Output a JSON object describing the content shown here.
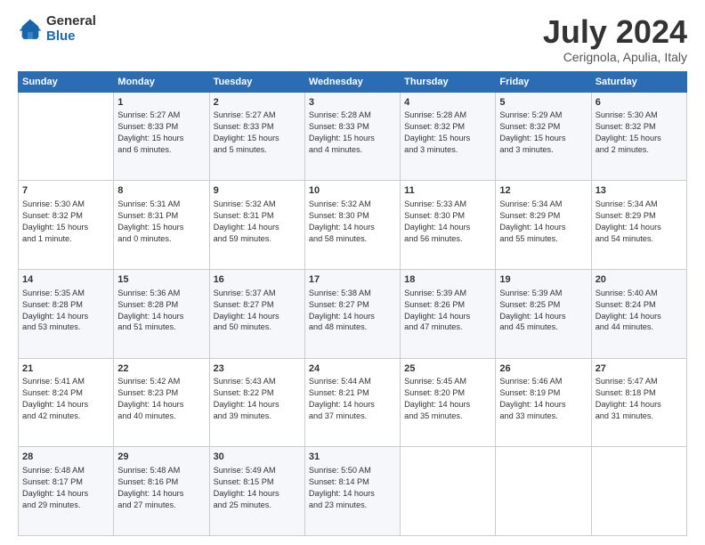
{
  "logo": {
    "general": "General",
    "blue": "Blue"
  },
  "header": {
    "title": "July 2024",
    "subtitle": "Cerignola, Apulia, Italy"
  },
  "weekdays": [
    "Sunday",
    "Monday",
    "Tuesday",
    "Wednesday",
    "Thursday",
    "Friday",
    "Saturday"
  ],
  "weeks": [
    [
      {
        "day": "",
        "info": ""
      },
      {
        "day": "1",
        "info": "Sunrise: 5:27 AM\nSunset: 8:33 PM\nDaylight: 15 hours\nand 6 minutes."
      },
      {
        "day": "2",
        "info": "Sunrise: 5:27 AM\nSunset: 8:33 PM\nDaylight: 15 hours\nand 5 minutes."
      },
      {
        "day": "3",
        "info": "Sunrise: 5:28 AM\nSunset: 8:33 PM\nDaylight: 15 hours\nand 4 minutes."
      },
      {
        "day": "4",
        "info": "Sunrise: 5:28 AM\nSunset: 8:32 PM\nDaylight: 15 hours\nand 3 minutes."
      },
      {
        "day": "5",
        "info": "Sunrise: 5:29 AM\nSunset: 8:32 PM\nDaylight: 15 hours\nand 3 minutes."
      },
      {
        "day": "6",
        "info": "Sunrise: 5:30 AM\nSunset: 8:32 PM\nDaylight: 15 hours\nand 2 minutes."
      }
    ],
    [
      {
        "day": "7",
        "info": "Sunrise: 5:30 AM\nSunset: 8:32 PM\nDaylight: 15 hours\nand 1 minute."
      },
      {
        "day": "8",
        "info": "Sunrise: 5:31 AM\nSunset: 8:31 PM\nDaylight: 15 hours\nand 0 minutes."
      },
      {
        "day": "9",
        "info": "Sunrise: 5:32 AM\nSunset: 8:31 PM\nDaylight: 14 hours\nand 59 minutes."
      },
      {
        "day": "10",
        "info": "Sunrise: 5:32 AM\nSunset: 8:30 PM\nDaylight: 14 hours\nand 58 minutes."
      },
      {
        "day": "11",
        "info": "Sunrise: 5:33 AM\nSunset: 8:30 PM\nDaylight: 14 hours\nand 56 minutes."
      },
      {
        "day": "12",
        "info": "Sunrise: 5:34 AM\nSunset: 8:29 PM\nDaylight: 14 hours\nand 55 minutes."
      },
      {
        "day": "13",
        "info": "Sunrise: 5:34 AM\nSunset: 8:29 PM\nDaylight: 14 hours\nand 54 minutes."
      }
    ],
    [
      {
        "day": "14",
        "info": "Sunrise: 5:35 AM\nSunset: 8:28 PM\nDaylight: 14 hours\nand 53 minutes."
      },
      {
        "day": "15",
        "info": "Sunrise: 5:36 AM\nSunset: 8:28 PM\nDaylight: 14 hours\nand 51 minutes."
      },
      {
        "day": "16",
        "info": "Sunrise: 5:37 AM\nSunset: 8:27 PM\nDaylight: 14 hours\nand 50 minutes."
      },
      {
        "day": "17",
        "info": "Sunrise: 5:38 AM\nSunset: 8:27 PM\nDaylight: 14 hours\nand 48 minutes."
      },
      {
        "day": "18",
        "info": "Sunrise: 5:39 AM\nSunset: 8:26 PM\nDaylight: 14 hours\nand 47 minutes."
      },
      {
        "day": "19",
        "info": "Sunrise: 5:39 AM\nSunset: 8:25 PM\nDaylight: 14 hours\nand 45 minutes."
      },
      {
        "day": "20",
        "info": "Sunrise: 5:40 AM\nSunset: 8:24 PM\nDaylight: 14 hours\nand 44 minutes."
      }
    ],
    [
      {
        "day": "21",
        "info": "Sunrise: 5:41 AM\nSunset: 8:24 PM\nDaylight: 14 hours\nand 42 minutes."
      },
      {
        "day": "22",
        "info": "Sunrise: 5:42 AM\nSunset: 8:23 PM\nDaylight: 14 hours\nand 40 minutes."
      },
      {
        "day": "23",
        "info": "Sunrise: 5:43 AM\nSunset: 8:22 PM\nDaylight: 14 hours\nand 39 minutes."
      },
      {
        "day": "24",
        "info": "Sunrise: 5:44 AM\nSunset: 8:21 PM\nDaylight: 14 hours\nand 37 minutes."
      },
      {
        "day": "25",
        "info": "Sunrise: 5:45 AM\nSunset: 8:20 PM\nDaylight: 14 hours\nand 35 minutes."
      },
      {
        "day": "26",
        "info": "Sunrise: 5:46 AM\nSunset: 8:19 PM\nDaylight: 14 hours\nand 33 minutes."
      },
      {
        "day": "27",
        "info": "Sunrise: 5:47 AM\nSunset: 8:18 PM\nDaylight: 14 hours\nand 31 minutes."
      }
    ],
    [
      {
        "day": "28",
        "info": "Sunrise: 5:48 AM\nSunset: 8:17 PM\nDaylight: 14 hours\nand 29 minutes."
      },
      {
        "day": "29",
        "info": "Sunrise: 5:48 AM\nSunset: 8:16 PM\nDaylight: 14 hours\nand 27 minutes."
      },
      {
        "day": "30",
        "info": "Sunrise: 5:49 AM\nSunset: 8:15 PM\nDaylight: 14 hours\nand 25 minutes."
      },
      {
        "day": "31",
        "info": "Sunrise: 5:50 AM\nSunset: 8:14 PM\nDaylight: 14 hours\nand 23 minutes."
      },
      {
        "day": "",
        "info": ""
      },
      {
        "day": "",
        "info": ""
      },
      {
        "day": "",
        "info": ""
      }
    ]
  ]
}
